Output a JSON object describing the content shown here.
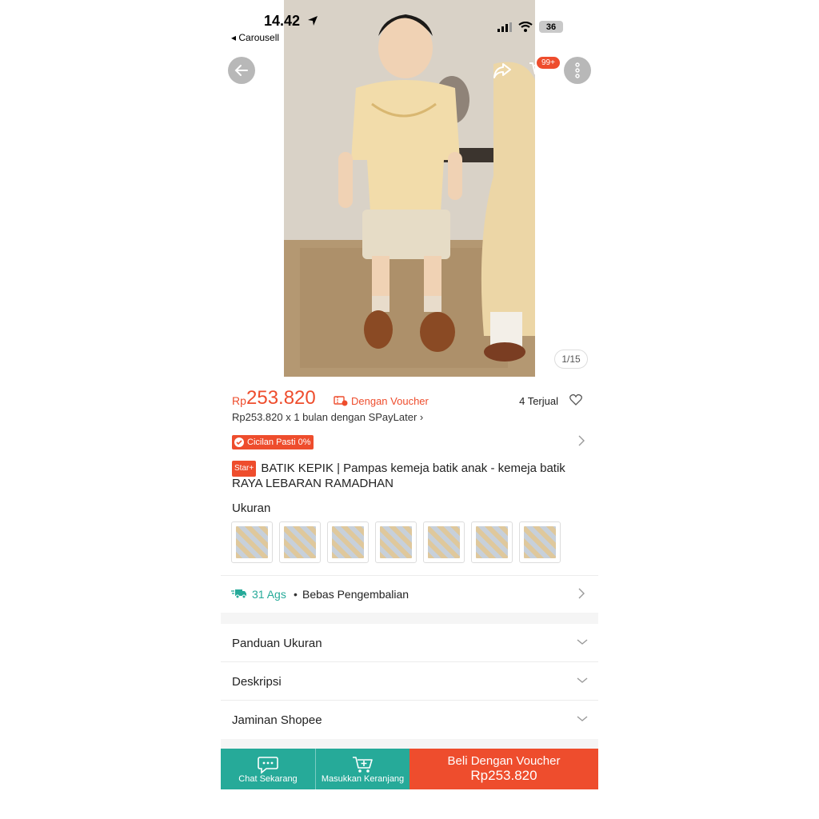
{
  "status_bar": {
    "time": "14.42",
    "back_app": "◂ Carousell",
    "battery": "36"
  },
  "header": {
    "cart_badge": "99+"
  },
  "gallery": {
    "indicator": "1/15"
  },
  "price": {
    "currency": "Rp",
    "amount": "253.820",
    "voucher_text": "Dengan Voucher",
    "sold": "4 Terjual",
    "spaylater": "Rp253.820 x 1 bulan dengan SPayLater ›"
  },
  "promo": {
    "cicilan": "Cicilan Pasti 0%"
  },
  "product": {
    "badge": "Star+",
    "title": "BATIK KEPIK | Pampas kemeja batik anak - kemeja batik RAYA LEBARAN RAMADHAN"
  },
  "sizes": {
    "label": "Ukuran",
    "count": 7
  },
  "shipping": {
    "date": "31 Ags",
    "dot": "•",
    "returns": "Bebas Pengembalian"
  },
  "accordions": {
    "size_guide": "Panduan Ukuran",
    "description": "Deskripsi",
    "guarantee": "Jaminan Shopee"
  },
  "bottom_bar": {
    "chat": "Chat Sekarang",
    "add_cart": "Masukkan Keranjang",
    "buy_label": "Beli Dengan Voucher",
    "buy_price": "Rp253.820"
  },
  "colors": {
    "brand": "#ee4d2d",
    "teal": "#26aa99"
  }
}
